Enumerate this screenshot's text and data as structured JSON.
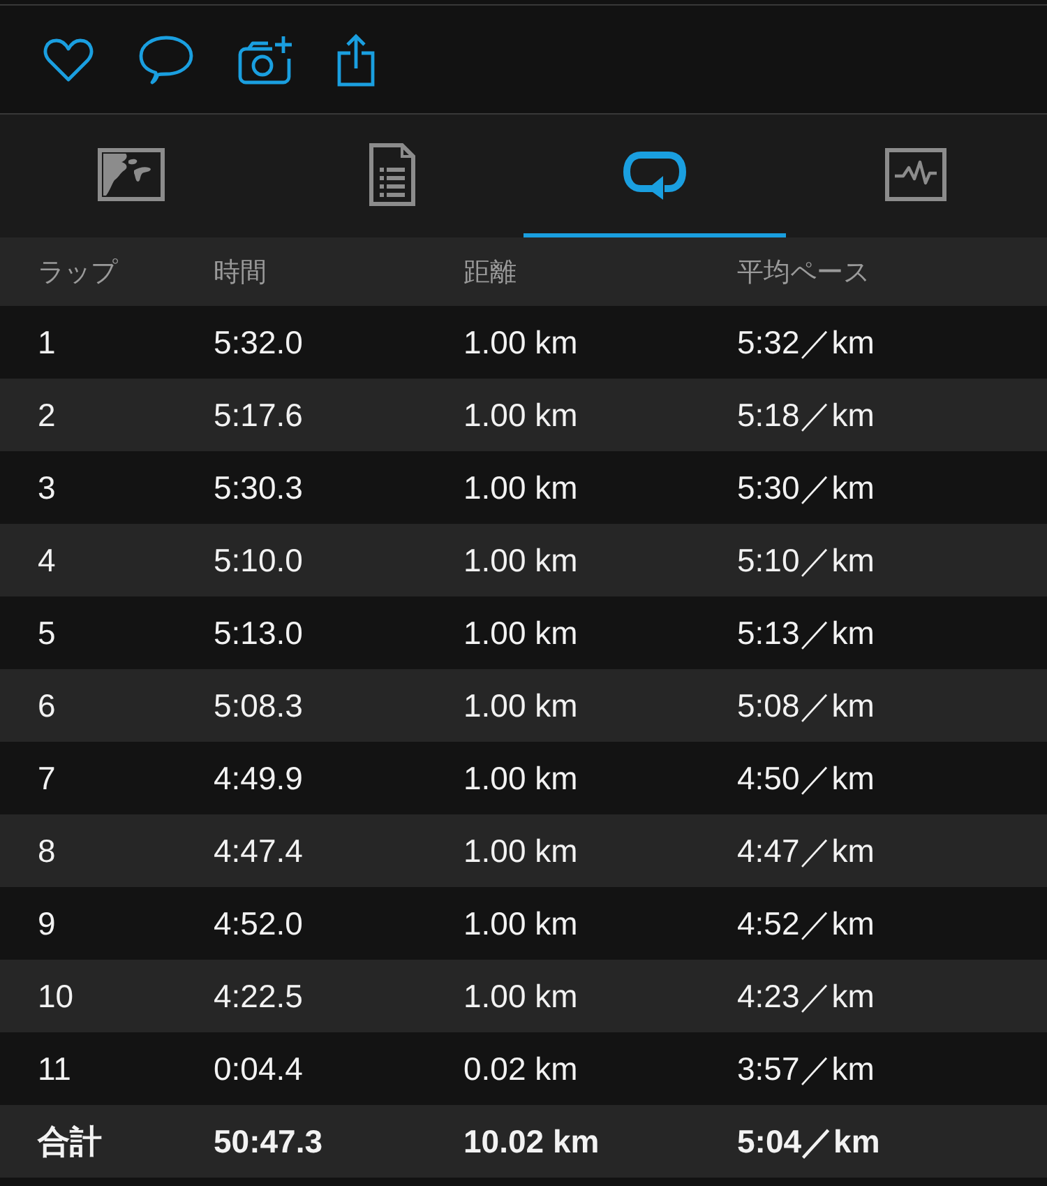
{
  "tabs": [
    {
      "selected": false
    },
    {
      "selected": false
    },
    {
      "selected": true
    },
    {
      "selected": false
    }
  ],
  "table": {
    "columns": [
      "ラップ",
      "時間",
      "距離",
      "平均ペース"
    ],
    "rows": [
      [
        "1",
        "5:32.0",
        "1.00 km",
        "5:32／km"
      ],
      [
        "2",
        "5:17.6",
        "1.00 km",
        "5:18／km"
      ],
      [
        "3",
        "5:30.3",
        "1.00 km",
        "5:30／km"
      ],
      [
        "4",
        "5:10.0",
        "1.00 km",
        "5:10／km"
      ],
      [
        "5",
        "5:13.0",
        "1.00 km",
        "5:13／km"
      ],
      [
        "6",
        "5:08.3",
        "1.00 km",
        "5:08／km"
      ],
      [
        "7",
        "4:49.9",
        "1.00 km",
        "4:50／km"
      ],
      [
        "8",
        "4:47.4",
        "1.00 km",
        "4:47／km"
      ],
      [
        "9",
        "4:52.0",
        "1.00 km",
        "4:52／km"
      ],
      [
        "10",
        "4:22.5",
        "1.00 km",
        "4:23／km"
      ],
      [
        "11",
        "0:04.4",
        "0.02 km",
        "3:57／km"
      ]
    ],
    "total": [
      "合計",
      "50:47.3",
      "10.02 km",
      "5:04／km"
    ]
  }
}
